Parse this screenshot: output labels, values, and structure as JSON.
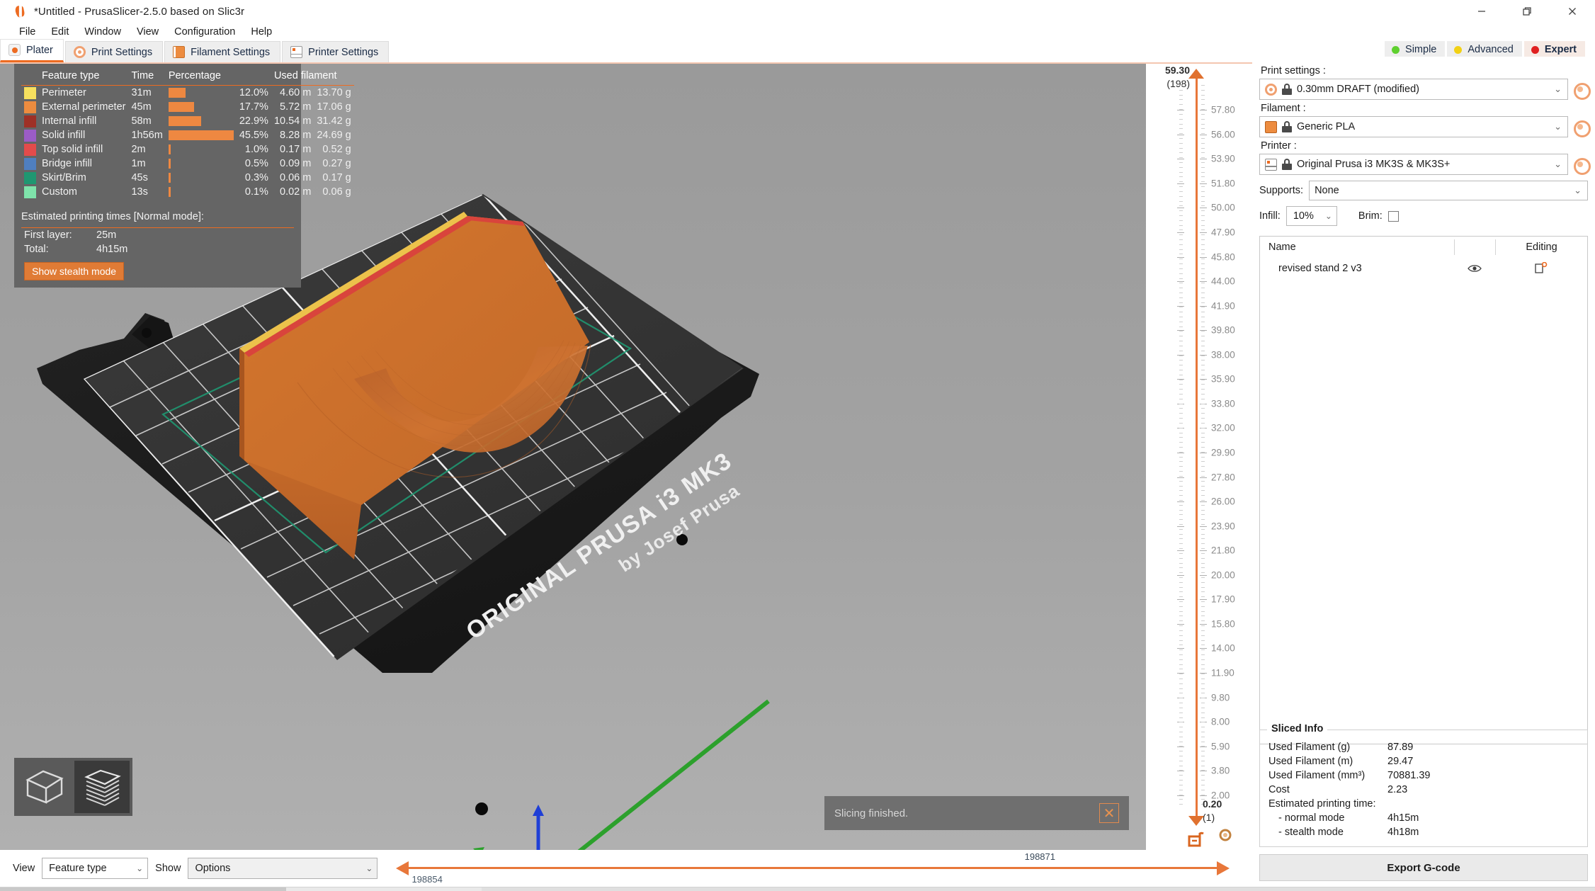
{
  "window": {
    "title": "*Untitled - PrusaSlicer-2.5.0 based on Slic3r",
    "minimize": "–",
    "maximize": "❐",
    "close": "✕"
  },
  "menu": [
    "File",
    "Edit",
    "Window",
    "View",
    "Configuration",
    "Help"
  ],
  "tabs": [
    {
      "label": "Plater",
      "icon": "plater-icon",
      "active": true
    },
    {
      "label": "Print Settings",
      "icon": "print-settings-icon",
      "active": false
    },
    {
      "label": "Filament Settings",
      "icon": "filament-settings-icon",
      "active": false
    },
    {
      "label": "Printer Settings",
      "icon": "printer-settings-icon",
      "active": false
    }
  ],
  "modes": [
    {
      "label": "Simple",
      "color": "#5fd02f",
      "active": false
    },
    {
      "label": "Advanced",
      "color": "#f2d115",
      "active": false
    },
    {
      "label": "Expert",
      "color": "#e02020",
      "active": true
    }
  ],
  "legend": {
    "headers": [
      "Feature type",
      "Time",
      "Percentage",
      "Used filament"
    ],
    "rows": [
      {
        "color": "#f6e05e",
        "feature": "Perimeter",
        "time": "31m",
        "pct": "12.0%",
        "pct_val": 12.0,
        "len": "4.60 m",
        "mass": "13.70 g"
      },
      {
        "color": "#ed8c3f",
        "feature": "External perimeter",
        "time": "45m",
        "pct": "17.7%",
        "pct_val": 17.7,
        "len": "5.72 m",
        "mass": "17.06 g"
      },
      {
        "color": "#9e3026",
        "feature": "Internal infill",
        "time": "58m",
        "pct": "22.9%",
        "pct_val": 22.9,
        "len": "10.54 m",
        "mass": "31.42 g"
      },
      {
        "color": "#9b5cc6",
        "feature": "Solid infill",
        "time": "1h56m",
        "pct": "45.5%",
        "pct_val": 45.5,
        "len": "8.28 m",
        "mass": "24.69 g"
      },
      {
        "color": "#e34b4b",
        "feature": "Top solid infill",
        "time": "2m",
        "pct": "1.0%",
        "pct_val": 1.0,
        "len": "0.17 m",
        "mass": "0.52 g"
      },
      {
        "color": "#4f7fc0",
        "feature": "Bridge infill",
        "time": "1m",
        "pct": "0.5%",
        "pct_val": 0.5,
        "len": "0.09 m",
        "mass": "0.27 g"
      },
      {
        "color": "#1f9771",
        "feature": "Skirt/Brim",
        "time": "45s",
        "pct": "0.3%",
        "pct_val": 0.3,
        "len": "0.06 m",
        "mass": "0.17 g"
      },
      {
        "color": "#7fe3ab",
        "feature": "Custom",
        "time": "13s",
        "pct": "0.1%",
        "pct_val": 0.1,
        "len": "0.02 m",
        "mass": "0.06 g"
      }
    ],
    "est_title": "Estimated printing times [Normal mode]:",
    "first_layer_key": "First layer:",
    "first_layer_val": "25m",
    "total_key": "Total:",
    "total_val": "4h15m",
    "stealth_button": "Show stealth mode"
  },
  "viewport": {
    "bed_logo_line1": "ORIGINAL PRUSA i3 MK3",
    "bed_logo_line2": "by Josef Prusa",
    "notification": "Slicing finished.",
    "notification_close": "✕",
    "view_mode_3d": "3d-editor-view-icon",
    "view_mode_preview": "preview-layers-icon"
  },
  "layer_slider": {
    "top_value": "59.30",
    "top_layer": "(198)",
    "bottom_value": "0.20",
    "bottom_layer": "(1)",
    "ticks": [
      "57.80",
      "56.00",
      "53.90",
      "51.80",
      "50.00",
      "47.90",
      "45.80",
      "44.00",
      "41.90",
      "39.80",
      "38.00",
      "35.90",
      "33.80",
      "32.00",
      "29.90",
      "27.80",
      "26.00",
      "23.90",
      "21.80",
      "20.00",
      "17.90",
      "15.80",
      "14.00",
      "11.90",
      "9.80",
      "8.00",
      "5.90",
      "3.80",
      "2.00"
    ],
    "lock_icon": "unlocked-padlock-icon",
    "gear_icon": "gear-icon"
  },
  "right_panel": {
    "print_settings_label": "Print settings :",
    "print_settings_value": "0.30mm DRAFT (modified)",
    "filament_label": "Filament :",
    "filament_value": "Generic PLA",
    "printer_label": "Printer :",
    "printer_value": "Original Prusa i3 MK3S & MK3S+",
    "supports_label": "Supports:",
    "supports_value": "None",
    "infill_label": "Infill:",
    "infill_value": "10%",
    "brim_label": "Brim:",
    "chevron": "⌄",
    "object_list": {
      "col_name": "Name",
      "col_editing": "Editing",
      "rows": [
        {
          "name": "revised stand 2 v3",
          "eye": "eye-icon",
          "edit": "editing-icon"
        }
      ]
    },
    "sliced_info": {
      "title": "Sliced Info",
      "rows": [
        {
          "key": "Used Filament (g)",
          "value": "87.89"
        },
        {
          "key": "Used Filament (m)",
          "value": "29.47"
        },
        {
          "key": "Used Filament (mm³)",
          "value": "70881.39"
        },
        {
          "key": "Cost",
          "value": "2.23"
        }
      ],
      "time_title": "Estimated printing time:",
      "time_rows": [
        {
          "key": "- normal mode",
          "value": "4h15m"
        },
        {
          "key": "- stealth mode",
          "value": "4h18m"
        }
      ]
    },
    "export_button": "Export G-code"
  },
  "bottom_bar": {
    "view_label": "View",
    "view_value": "Feature type",
    "show_label": "Show",
    "show_value": "Options",
    "chevron": "⌄",
    "slider_left_value": "198854",
    "slider_right_value": "198871"
  }
}
